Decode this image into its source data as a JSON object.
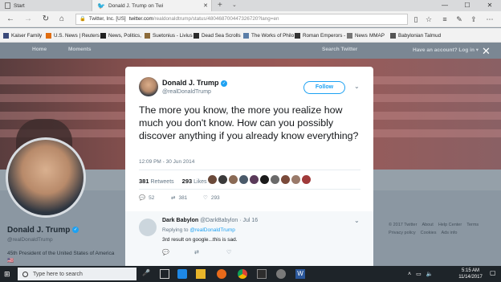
{
  "browser": {
    "tabs": [
      {
        "label": "Start"
      },
      {
        "label": "Donald J. Trump on Twi"
      }
    ],
    "address": {
      "cert": "Twitter, Inc. [US]",
      "url": "twitter.com",
      "rest": "/realdonaldtrump/status/480468700447326720?lang=en"
    },
    "favorites": [
      {
        "label": "Kaiser Family",
        "color": "#3b4a7a"
      },
      {
        "label": "U.S. News | Reuters",
        "color": "#e06d10"
      },
      {
        "label": "News, Politics,",
        "color": "#222222"
      },
      {
        "label": "Suetonius - Livius",
        "color": "#8c6b3a"
      },
      {
        "label": "Dead Sea Scrolls",
        "color": "#2b2b2b"
      },
      {
        "label": "The Works of Philo",
        "color": "#5b7ea8"
      },
      {
        "label": "Roman Emperors -",
        "color": "#333333"
      },
      {
        "label": "News",
        "color": "#777777"
      },
      {
        "label": "MMAP",
        "color": "#777777"
      },
      {
        "label": "Babylonian Talmud",
        "color": "#555555"
      }
    ]
  },
  "twitter_nav": {
    "home": "Home",
    "moments": "Moments",
    "search_placeholder": "Search Twitter",
    "account": "Have an account? Log in ▾"
  },
  "profile": {
    "name": "Donald J. Trump",
    "handle": "@realDonaldTrump",
    "bio": "45th President of the United States of America🇺🇸"
  },
  "footer_links": [
    "© 2017 Twitter",
    "About",
    "Help Center",
    "Terms",
    "Privacy policy",
    "Cookies",
    "Ads info"
  ],
  "tweet": {
    "name": "Donald J. Trump",
    "handle": "@realDonaldTrump",
    "follow": "Follow",
    "text": "The more you know, the more you realize how much you don't know. How can you possibly discover anything if you already know everything?",
    "time": "12:09 PM - 30 Jun 2014",
    "retweets": "381",
    "retweets_label": "Retweets",
    "likes": "293",
    "likes_label": "Likes",
    "reply_count": "52",
    "retweet_count": "381",
    "like_count": "293",
    "liker_colors": [
      "#6b4a3a",
      "#3a3a3a",
      "#8a6a55",
      "#4a5a6a",
      "#5a3a5a",
      "#1a1a1a",
      "#6a6a6a",
      "#7a4a3a",
      "#9a7a6a",
      "#a03a3a"
    ]
  },
  "reply": {
    "name": "Dark Babylon",
    "meta": "@DarkBabylon · Jul 16",
    "replying_prefix": "Replying to",
    "replying_to": "@realDonaldTrump",
    "text": "3rd result on google...this is sad."
  },
  "taskbar": {
    "search_placeholder": "Type here to search",
    "time": "5:15 AM",
    "date": "11/14/2017"
  }
}
